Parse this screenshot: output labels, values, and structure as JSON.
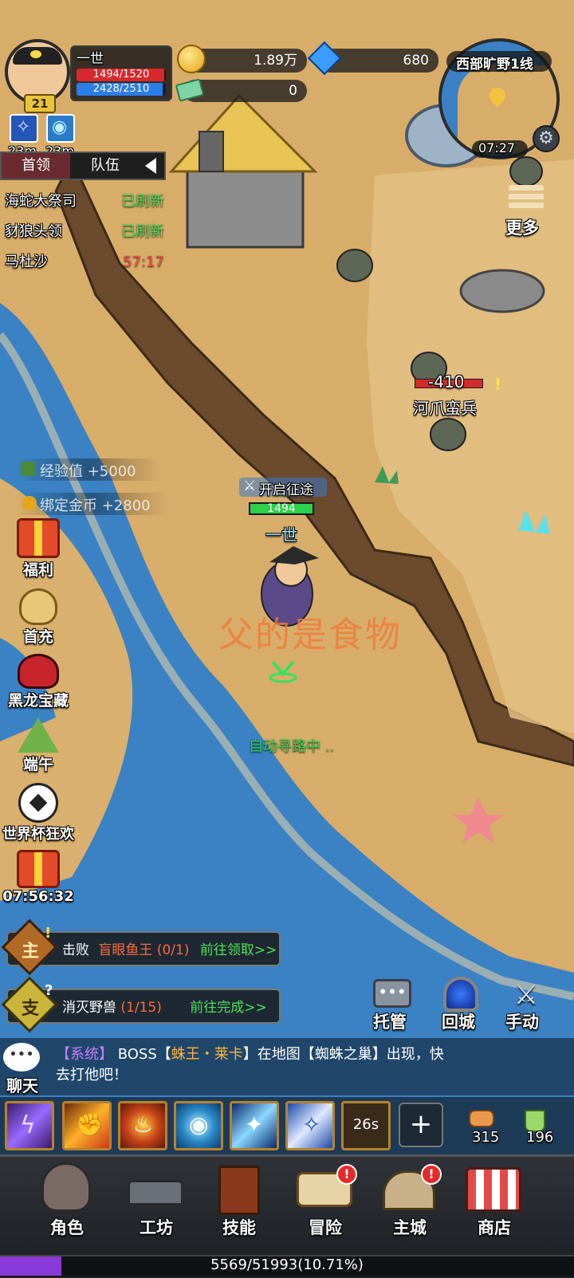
{
  "player": {
    "name": "一世",
    "level": "21",
    "hp": "1494/1520",
    "mp": "2428/2510",
    "hp_ratio": 0.983,
    "mp_ratio": 0.967
  },
  "buffs": [
    {
      "icon": "feather-buff-icon",
      "timer": "23m"
    },
    {
      "icon": "eye-buff-icon",
      "timer": "23m"
    }
  ],
  "currency": {
    "gold": "1.89万",
    "gems": "680",
    "tickets": "0"
  },
  "minimap": {
    "zone": "西部旷野1线",
    "time": "07:27",
    "more_label": "更多"
  },
  "boss_tabs": {
    "tab1": "首领",
    "tab2": "队伍"
  },
  "bosses": [
    {
      "name": "海蛇大祭司",
      "status": "已刷新"
    },
    {
      "name": "豺狼头领",
      "status": "已刷新"
    },
    {
      "name": "马杜沙",
      "status": "57:17"
    }
  ],
  "rewards": {
    "exp": "经验值 +5000",
    "gold": "绑定金币 +2800"
  },
  "hero_overhead": {
    "banner": "开启征途",
    "hp": "1494",
    "name": "一世"
  },
  "enemy": {
    "label": "河爪蛮兵",
    "damage": "-410"
  },
  "overlay_text": "父的是食物",
  "auto_path": "自动寻路中 ..",
  "side_menu": [
    "福利",
    "首充",
    "黑龙宝藏",
    "端午",
    "世界杯狂欢",
    "07:56:32"
  ],
  "quests": [
    {
      "badge": "主",
      "prefix": "击败",
      "target": "盲眼鱼王",
      "progress": "(0/1)",
      "action": "前往领取>>"
    },
    {
      "badge": "支",
      "prefix": "消灭野兽",
      "target": "",
      "progress": "(1/15)",
      "action": "前往完成>>"
    }
  ],
  "actions": {
    "auto": "托管",
    "return": "回城",
    "manual": "手动"
  },
  "chat": {
    "label": "聊天",
    "tag": "【系统】",
    "t1": "BOSS【",
    "boss": "蛛王・莱卡",
    "t2": "】在地图【蜘蛛之巢】出现，快",
    "t3": "去打他吧！"
  },
  "skills": {
    "cooldown": "26s",
    "item1_count": "315",
    "item2_count": "196"
  },
  "nav": [
    "角色",
    "工坊",
    "技能",
    "冒险",
    "主城",
    "商店"
  ],
  "exp_bar": {
    "text": "5569/51993(10.71%)",
    "ratio": 0.1071
  }
}
